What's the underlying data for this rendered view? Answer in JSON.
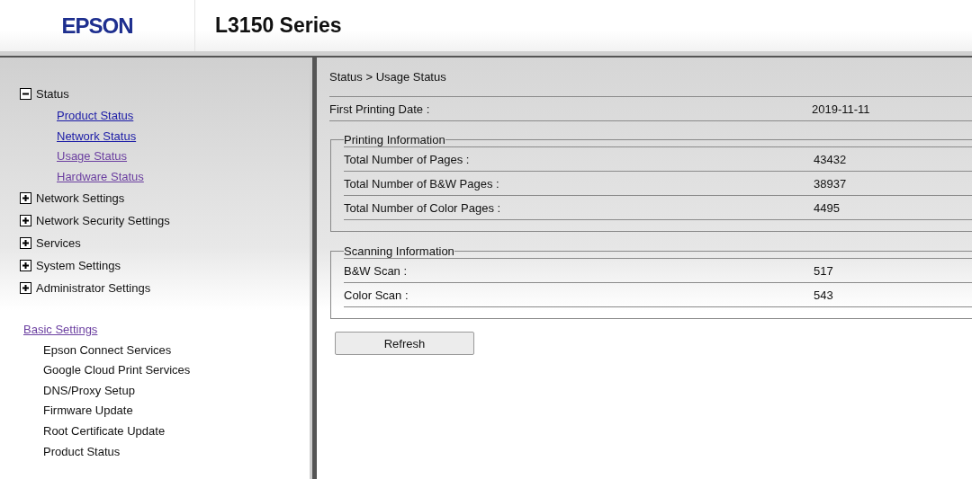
{
  "header": {
    "logo": "EPSON",
    "title": "L3150 Series"
  },
  "sidebar": {
    "tree": [
      {
        "label": "Status",
        "expanded": true,
        "children": [
          {
            "label": "Product Status",
            "visited": false
          },
          {
            "label": "Network Status",
            "visited": false
          },
          {
            "label": "Usage Status",
            "visited": true
          },
          {
            "label": "Hardware Status",
            "visited": true
          }
        ]
      },
      {
        "label": "Network Settings",
        "expanded": false
      },
      {
        "label": "Network Security Settings",
        "expanded": false
      },
      {
        "label": "Services",
        "expanded": false
      },
      {
        "label": "System Settings",
        "expanded": false
      },
      {
        "label": "Administrator Settings",
        "expanded": false
      }
    ],
    "basic_settings": {
      "label": "Basic Settings",
      "visited": true,
      "items": [
        "Epson Connect Services",
        "Google Cloud Print Services",
        "DNS/Proxy Setup",
        "Firmware Update",
        "Root Certificate Update",
        "Product Status"
      ]
    }
  },
  "content": {
    "breadcrumb": "Status > Usage Status",
    "first_printing": {
      "label": "First Printing Date :",
      "value": "2019-11-11"
    },
    "groups": [
      {
        "legend": "Printing Information",
        "rows": [
          {
            "label": "Total Number of Pages :",
            "value": "43432"
          },
          {
            "label": "Total Number of B&W Pages :",
            "value": "38937"
          },
          {
            "label": "Total Number of Color Pages :",
            "value": "4495"
          }
        ]
      },
      {
        "legend": "Scanning Information",
        "rows": [
          {
            "label": "B&W Scan :",
            "value": "517"
          },
          {
            "label": "Color Scan :",
            "value": "543"
          }
        ]
      }
    ],
    "button": "Refresh"
  }
}
